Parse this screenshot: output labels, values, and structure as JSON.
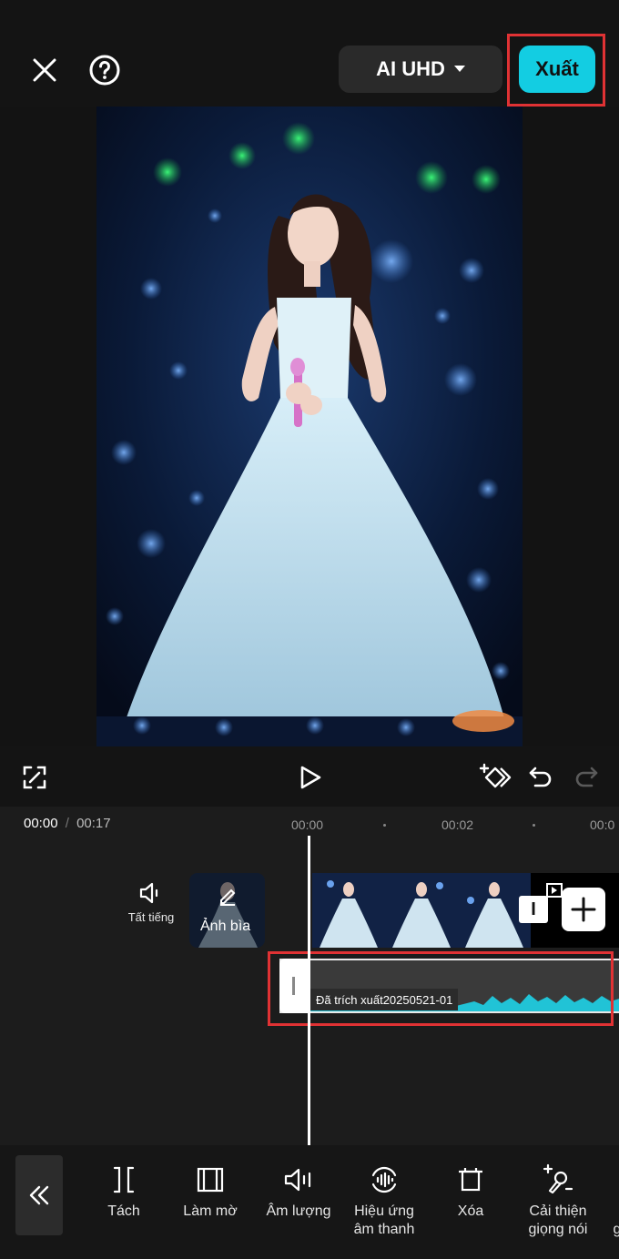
{
  "header": {
    "close_icon": "close-icon",
    "help_icon": "help-icon",
    "quality_label": "AI UHD",
    "export_label": "Xuất"
  },
  "controls": {
    "fullscreen_icon": "fullscreen-icon",
    "play_icon": "play-icon",
    "keyframe_icon": "keyframe-icon",
    "undo_icon": "undo-icon",
    "redo_icon": "redo-icon"
  },
  "timeline": {
    "current_time": "00:00",
    "separator": "/",
    "total_time": "00:17",
    "ruler": [
      "00:00",
      "00:02",
      "00:0"
    ],
    "mute_label": "Tất tiếng",
    "cover_label": "Ảnh bìa",
    "clip_end_label": "I",
    "audio_clip_label": "Đã trích xuất20250521-01"
  },
  "toolbar": {
    "items": [
      {
        "label": "Tách",
        "icon": "split-icon"
      },
      {
        "label": "Làm mờ",
        "icon": "fade-icon"
      },
      {
        "label": "Âm lượng",
        "icon": "volume-icon"
      },
      {
        "label": "Hiệu ứng\nâm thanh",
        "icon": "sound-effect-icon"
      },
      {
        "label": "Xóa",
        "icon": "delete-icon"
      },
      {
        "label": "Cải thiện\ngiọng nói",
        "icon": "voice-enhance-icon"
      },
      {
        "label": "g",
        "icon": ""
      }
    ]
  },
  "colors": {
    "accent": "#13cde2",
    "highlight": "#e03234",
    "background": "#131313"
  }
}
